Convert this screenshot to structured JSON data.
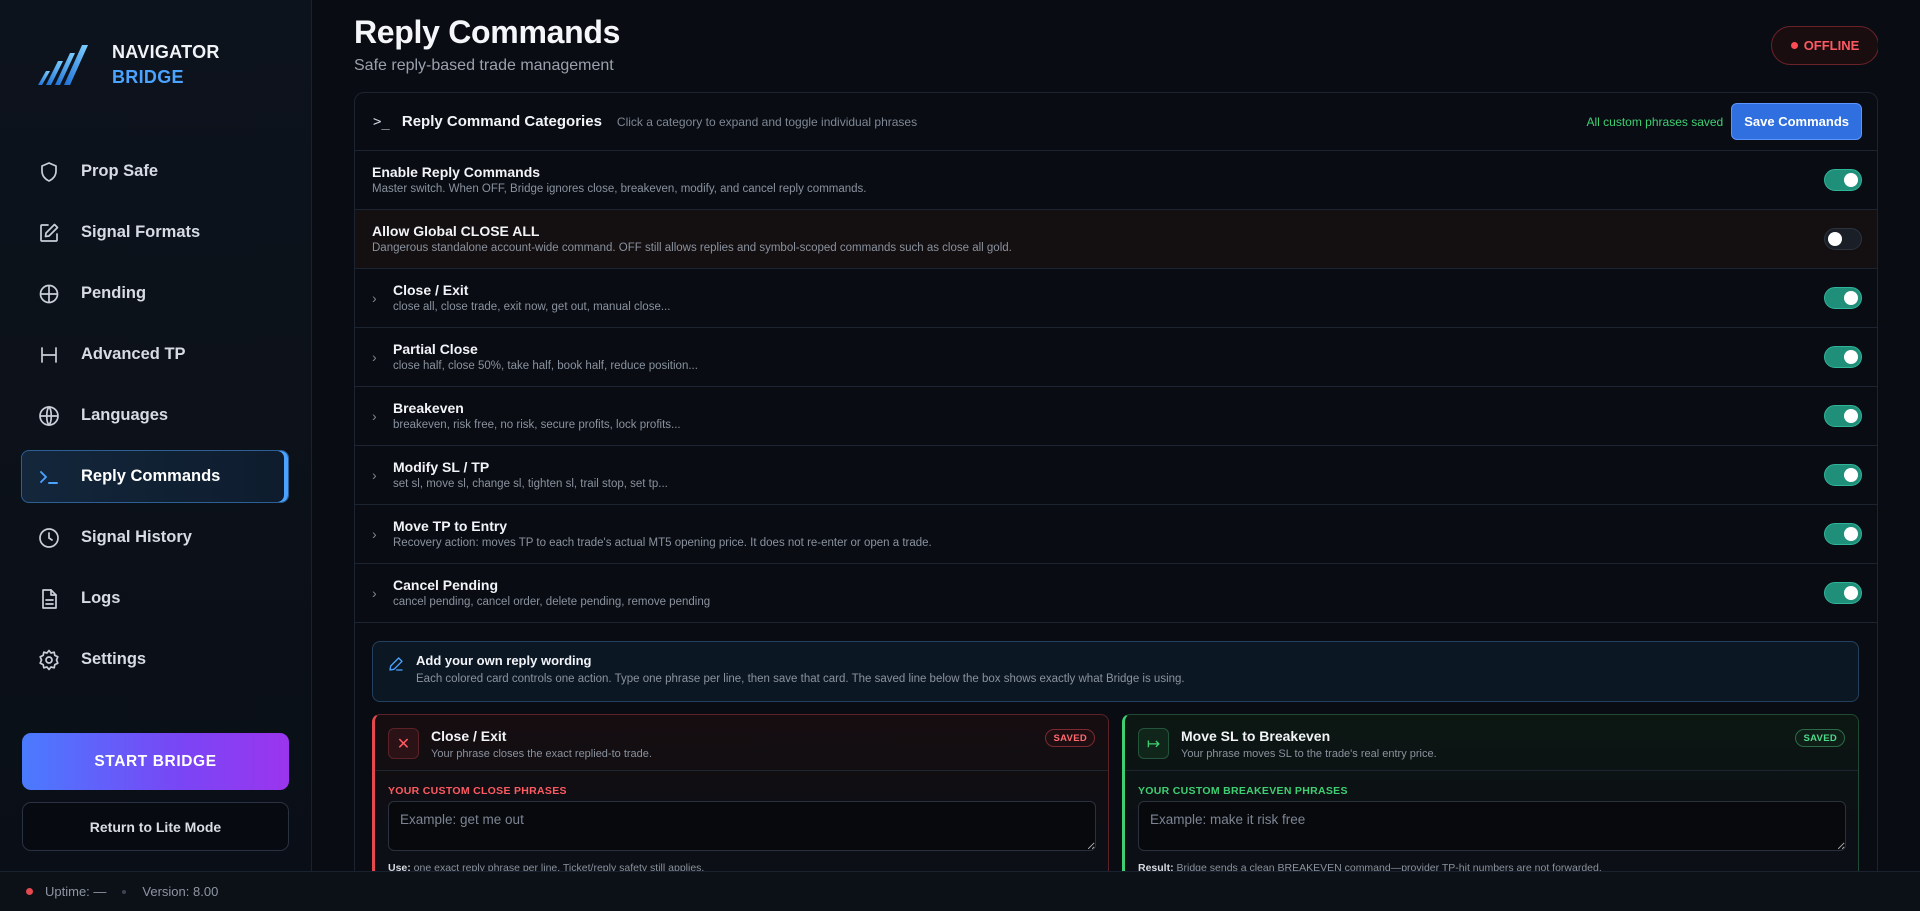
{
  "brand": {
    "line1": "NAVIGATOR",
    "line2": "BRIDGE"
  },
  "sidebar": {
    "items": [
      {
        "label": "Prop Safe",
        "icon": "shield-icon"
      },
      {
        "label": "Signal Formats",
        "icon": "edit-icon"
      },
      {
        "label": "Pending",
        "icon": "crosshair-icon"
      },
      {
        "label": "Advanced TP",
        "icon": "split-icon"
      },
      {
        "label": "Languages",
        "icon": "globe-icon"
      },
      {
        "label": "Reply Commands",
        "icon": "terminal-icon",
        "active": true
      },
      {
        "label": "Signal History",
        "icon": "clock-icon"
      },
      {
        "label": "Logs",
        "icon": "file-icon"
      },
      {
        "label": "Settings",
        "icon": "gear-icon"
      }
    ],
    "start_label": "START BRIDGE",
    "lite_label": "Return to Lite Mode"
  },
  "status": {
    "uptime": "Uptime: —",
    "version": "Version: 8.00"
  },
  "header": {
    "title": "Reply Commands",
    "subtitle": "Safe reply-based trade management",
    "status_badge": "OFFLINE"
  },
  "panel": {
    "title": "Reply Command Categories",
    "hint": "Click a category to expand and toggle individual phrases",
    "saved_msg": "All custom phrases saved",
    "save_label": "Save Commands",
    "rows": [
      {
        "title": "Enable Reply Commands",
        "desc": "Master switch. When OFF, Bridge ignores close, breakeven, modify, and cancel reply commands.",
        "on": true
      },
      {
        "title": "Allow Global CLOSE ALL",
        "desc": "Dangerous standalone account-wide command. OFF still allows replies and symbol-scoped commands such as close all gold.",
        "on": false
      },
      {
        "title": "Close / Exit",
        "desc": "close all, close trade, exit now, get out, manual close...",
        "on": true
      },
      {
        "title": "Partial Close",
        "desc": "close half, close 50%, take half, book half, reduce position...",
        "on": true
      },
      {
        "title": "Breakeven",
        "desc": "breakeven, risk free, no risk, secure profits, lock profits...",
        "on": true
      },
      {
        "title": "Modify SL / TP",
        "desc": "set sl, move sl, change sl, tighten sl, trail stop, set tp...",
        "on": true
      },
      {
        "title": "Move TP to Entry",
        "desc": "Recovery action: moves TP to each trade's actual MT5 opening price. It does not re-enter or open a trade.",
        "on": true
      },
      {
        "title": "Cancel Pending",
        "desc": "cancel pending, cancel order, delete pending, remove pending",
        "on": true
      }
    ],
    "info": {
      "title": "Add your own reply wording",
      "desc": "Each colored card controls one action. Type one phrase per line, then save that card. The saved line below the box shows exactly what Bridge is using."
    },
    "cards": [
      {
        "title": "Close / Exit",
        "desc": "Your phrase closes the exact replied-to trade.",
        "badge": "SAVED",
        "label": "YOUR CUSTOM CLOSE PHRASES",
        "placeholder": "Example: get me out",
        "foot_key": "Use:",
        "foot_text": " one exact reply phrase per line. Ticket/reply safety still applies."
      },
      {
        "title": "Move SL to Breakeven",
        "desc": "Your phrase moves SL to the trade's real entry price.",
        "badge": "SAVED",
        "label": "YOUR CUSTOM BREAKEVEN PHRASES",
        "placeholder": "Example: make it risk free",
        "foot_key": "Result:",
        "foot_text": " Bridge sends a clean BREAKEVEN command—provider TP-hit numbers are not forwarded."
      }
    ]
  },
  "colors": {
    "accent": "#4aa3ff",
    "toggle_on": "#1f8f7a",
    "danger": "#e5484d",
    "success": "#3fcf72"
  }
}
